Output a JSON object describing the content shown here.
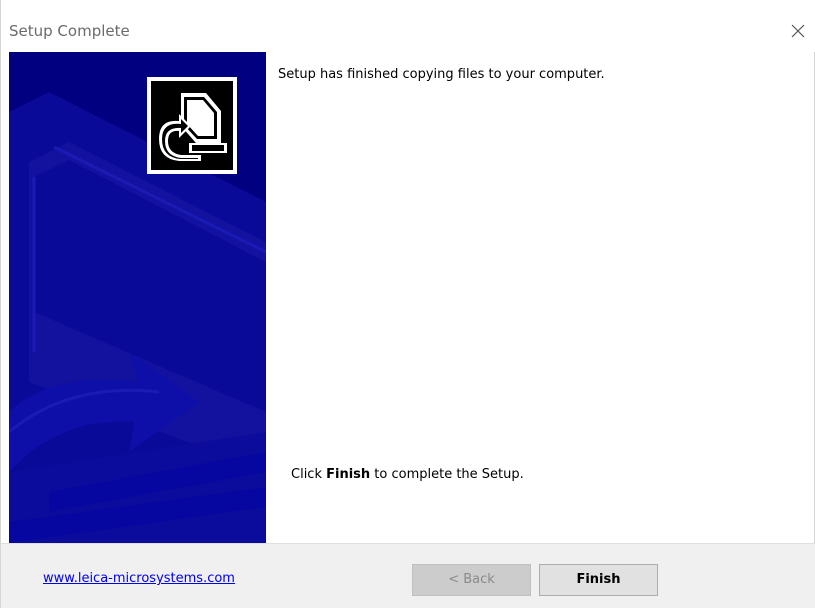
{
  "window": {
    "title": "Setup Complete",
    "close_icon": "close-icon"
  },
  "side_panel": {
    "background_color": "#000080",
    "icon": "setup-computer-icon"
  },
  "content": {
    "message": "Setup has finished copying files to your computer.",
    "finish_prefix": "Click ",
    "finish_bold": "Finish",
    "finish_suffix": " to complete the Setup."
  },
  "footer": {
    "link_text": "www.leica-microsystems.com",
    "back_label": "< Back",
    "finish_label": "Finish"
  }
}
